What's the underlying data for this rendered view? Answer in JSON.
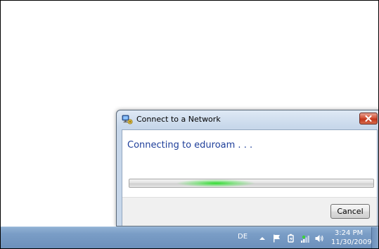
{
  "dialog": {
    "title": "Connect to a Network",
    "icon": "network-connection-icon",
    "close_icon": "close-icon",
    "heading": "Connecting to eduroam . . .",
    "progress": {
      "state": "indeterminate",
      "accent_color": "#2ed82e"
    },
    "cancel_label": "Cancel"
  },
  "taskbar": {
    "language": "DE",
    "tray_icons": [
      "show-hidden-icons-arrow-icon",
      "action-center-flag-icon",
      "power-icon",
      "network-signal-icon",
      "volume-icon"
    ],
    "clock": {
      "time": "3:24 PM",
      "date": "11/30/2009"
    }
  },
  "colors": {
    "heading_text": "#1f3f9a",
    "taskbar": "#7a9dc6",
    "close_button": "#c1351b"
  }
}
